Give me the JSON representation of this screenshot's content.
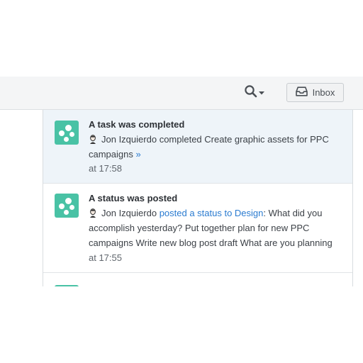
{
  "toolbar": {
    "search_icon": "search-icon",
    "dropdown_icon": "chevron-down-icon",
    "inbox_label": "Inbox",
    "inbox_icon": "inbox-tray-icon"
  },
  "feed": {
    "entries": [
      {
        "title": "A task was completed",
        "app_icon": "app-dots-icon",
        "user": "Jon Izquierdo",
        "text": "completed Create graphic assets for PPC campaigns",
        "more_link": "»",
        "time": "at 17:58"
      },
      {
        "title": "A status was posted",
        "app_icon": "app-dots-icon",
        "user": "Jon Izquierdo",
        "link_text": "posted a status to Design",
        "text": ": What did you accomplish yesterday? Put together plan for new PPC campaigns Write new blog post draft What are you planning",
        "time": "at 17:55"
      }
    ]
  },
  "colors": {
    "app_icon": "#49c2a5",
    "link": "#2a7bd0",
    "highlight_row": "#eef4f9",
    "toolbar_bg": "#f4f5f6"
  }
}
